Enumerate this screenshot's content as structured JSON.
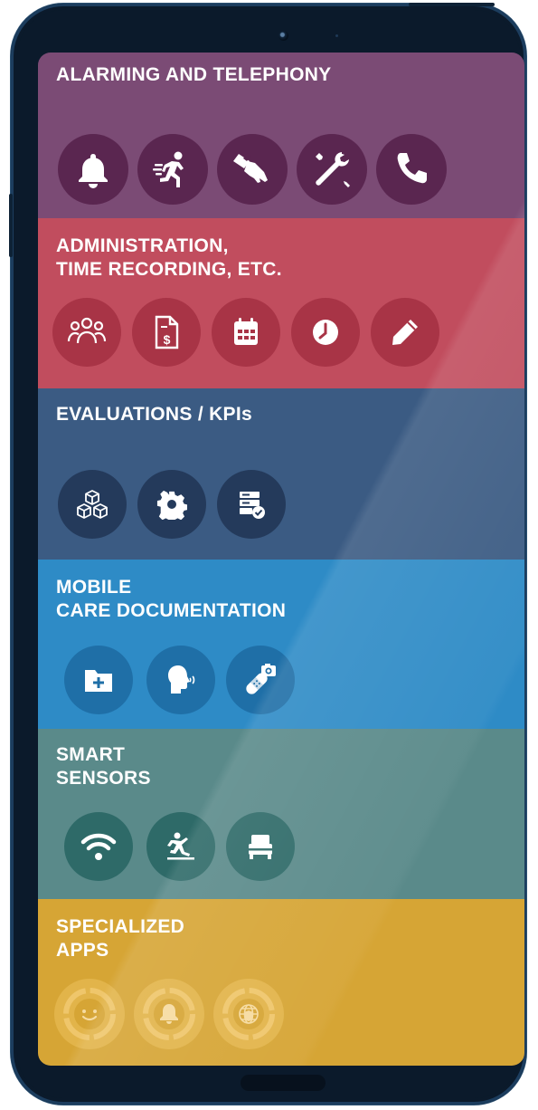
{
  "sections": [
    {
      "id": "alarming",
      "title_lines": [
        "ALARMING AND TELEPHONY"
      ],
      "color": "#7b4b75",
      "icon_color": "#5a2650",
      "icons": [
        "bell-icon",
        "running-person-icon",
        "wristband-icon",
        "tools-icon",
        "phone-icon"
      ]
    },
    {
      "id": "administration",
      "title_lines": [
        "ADMINISTRATION,",
        "TIME RECORDING, ETC."
      ],
      "color": "#c14d5e",
      "icon_color": "#a83446",
      "icons": [
        "group-icon",
        "invoice-icon",
        "calendar-icon",
        "clock-icon",
        "pencil-icon"
      ]
    },
    {
      "id": "evaluations",
      "title_lines": [
        "EVALUATIONS / KPIs"
      ],
      "color": "#3b5b83",
      "icon_color": "#243a5b",
      "icons": [
        "cubes-icon",
        "gear-icon",
        "server-check-icon"
      ]
    },
    {
      "id": "mobile-care",
      "title_lines": [
        "MOBILE",
        "CARE DOCUMENTATION"
      ],
      "color": "#2e8bc6",
      "icon_color": "#1f6fa7",
      "icons": [
        "folder-plus-icon",
        "speaking-head-icon",
        "bandage-camera-icon"
      ]
    },
    {
      "id": "smart-sensors",
      "title_lines": [
        "SMART",
        "SENSORS"
      ],
      "color": "#5a8a8a",
      "icon_color": "#2e6a68",
      "icons": [
        "wifi-icon",
        "fall-detection-icon",
        "bed-icon"
      ]
    },
    {
      "id": "specialized-apps",
      "title_lines": [
        "SPECIALIZED",
        "APPS"
      ],
      "color": "#d6a535",
      "icon_color": "#e2b44a",
      "icons": [
        "smiley-app-icon",
        "bell-app-icon",
        "globe-shield-app-icon"
      ]
    }
  ]
}
